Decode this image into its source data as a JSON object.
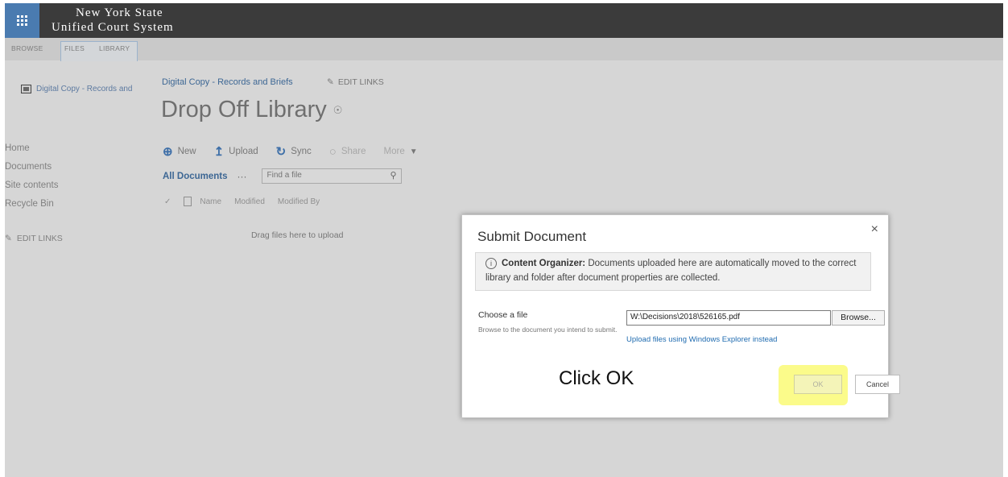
{
  "suite": {
    "brand_line1": "New York State",
    "brand_line2": "Unified Court System",
    "app_launcher_icon": "waffle-icon"
  },
  "ribbon": {
    "tabs": [
      "BROWSE",
      "FILES",
      "LIBRARY"
    ]
  },
  "site": {
    "logo_text": "Digital Copy - Records and",
    "breadcrumb": "Digital Copy - Records and Briefs",
    "edit_links": "EDIT LINKS",
    "page_title": "Drop Off Library"
  },
  "nav": {
    "items": [
      "Home",
      "Documents",
      "Site contents",
      "Recycle Bin"
    ],
    "edit_links": "EDIT LINKS"
  },
  "commands": {
    "new": "New",
    "upload": "Upload",
    "sync": "Sync",
    "share": "Share",
    "more": "More"
  },
  "view": {
    "name": "All Documents",
    "ellipsis": "···",
    "search_placeholder": "Find a file"
  },
  "columns": {
    "name": "Name",
    "modified": "Modified",
    "modified_by": "Modified By"
  },
  "drop_text": "Drag files here to upload",
  "dialog": {
    "title": "Submit Document",
    "close_symbol": "×",
    "notice_label": "Content Organizer:",
    "notice_text": "Documents uploaded here are automatically moved to the correct library and folder after document properties are collected.",
    "choose_label": "Choose a file",
    "choose_help": "Browse to the document you intend to submit.",
    "file_value": "W:\\Decisions\\2018\\526165.pdf",
    "browse_label": "Browse...",
    "upload_link": "Upload files using Windows Explorer instead",
    "ok_label": "OK",
    "cancel_label": "Cancel"
  },
  "annotation": "Click OK",
  "colors": {
    "suitebar": "#3b3b3b",
    "app_launcher": "#4a7bb0",
    "link": "#1f6bb0",
    "highlight": "#fbfb8a"
  }
}
